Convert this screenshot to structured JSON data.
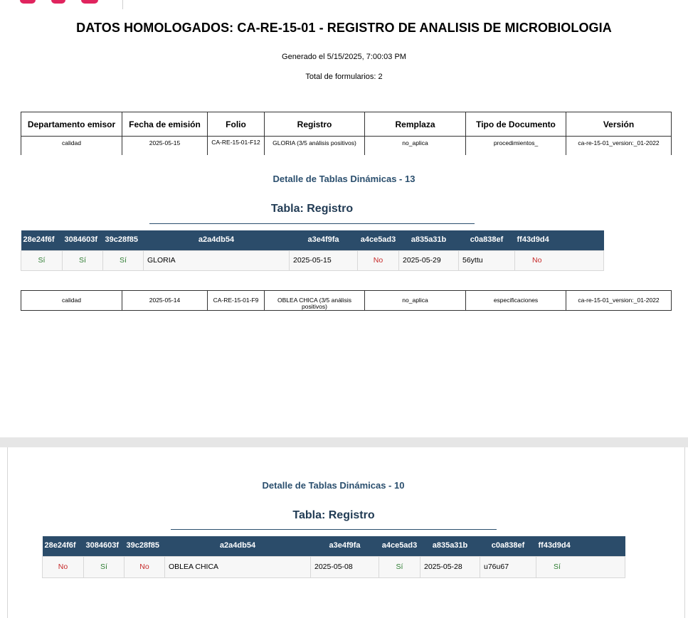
{
  "document": {
    "title": "DATOS HOMOLOGADOS: CA-RE-15-01 - REGISTRO DE ANALISIS DE MICROBIOLOGIA",
    "generated": "Generado el 5/15/2025, 7:00:03 PM",
    "total": "Total de formularios: 2"
  },
  "colors": {
    "brand": "#e0245e",
    "header_bg": "#2b4c6a",
    "si": "#2e7d32",
    "no": "#c62828"
  },
  "main_table": {
    "headers": [
      "Departamento emisor",
      "Fecha de emisión",
      "Folio",
      "Registro",
      "Remplaza",
      "Tipo de Documento",
      "Versión"
    ],
    "rows": [
      [
        "calidad",
        "2025-05-15",
        "CA-RE-15-01-F12",
        "GLORIA (3/5 análisis positivos)",
        "no_aplica",
        "procedimientos_",
        "ca-re-15-01_version:_01-2022"
      ],
      [
        "calidad",
        "2025-05-14",
        "CA-RE-15-01-F9",
        "OBLEA CHICA  (3/5 análisis positivos)",
        "no_aplica",
        "especificaciones",
        "ca-re-15-01_version:_01-2022"
      ]
    ]
  },
  "details": [
    {
      "section_title": "Detalle de Tablas Dinámicas - 13",
      "table_title": "Tabla: Registro",
      "headers": [
        "28e24f6f",
        "3084603f",
        "39c28f85",
        "a2a4db54",
        "a3e4f9fa",
        "a4ce5ad3",
        "a835a31b",
        "c0a838ef",
        "ff43d9d4"
      ],
      "row": [
        "Sí",
        "Sí",
        "Sí",
        "GLORIA",
        "2025-05-15",
        "No",
        "2025-05-29",
        "56yttu",
        "No"
      ]
    },
    {
      "section_title": "Detalle de Tablas Dinámicas - 10",
      "table_title": "Tabla: Registro",
      "headers": [
        "28e24f6f",
        "3084603f",
        "39c28f85",
        "a2a4db54",
        "a3e4f9fa",
        "a4ce5ad3",
        "a835a31b",
        "c0a838ef",
        "ff43d9d4"
      ],
      "row": [
        "No",
        "Sí",
        "No",
        "OBLEA CHICA",
        "2025-05-08",
        "Sí",
        "2025-05-28",
        "u76u67",
        "Sí"
      ]
    }
  ]
}
